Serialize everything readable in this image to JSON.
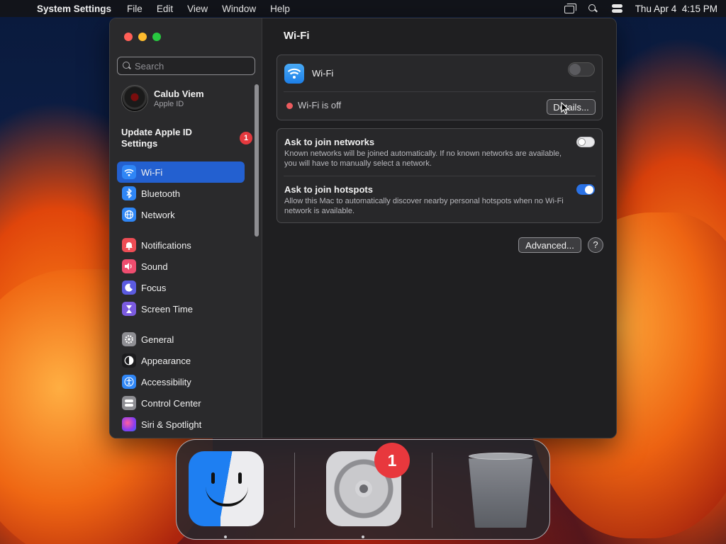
{
  "menubar": {
    "app_name": "System Settings",
    "menus": [
      "File",
      "Edit",
      "View",
      "Window",
      "Help"
    ],
    "clock": "Thu Apr 4  4:15 PM"
  },
  "sidebar": {
    "search_placeholder": "Search",
    "account": {
      "name": "Calub Viem",
      "subtitle": "Apple ID"
    },
    "update": {
      "label": "Update Apple ID Settings",
      "badge": "1"
    },
    "items": [
      {
        "label": "Wi-Fi",
        "icon": "wifi-icon",
        "color": "#2f86f6",
        "active": true
      },
      {
        "label": "Bluetooth",
        "icon": "bluetooth-icon",
        "color": "#2f86f6"
      },
      {
        "label": "Network",
        "icon": "globe-icon",
        "color": "#2f86f6"
      },
      {
        "label": "Notifications",
        "icon": "bell-icon",
        "color": "#ee4d55"
      },
      {
        "label": "Sound",
        "icon": "speaker-icon",
        "color": "#ee4d6f"
      },
      {
        "label": "Focus",
        "icon": "moon-icon",
        "color": "#5b5be0"
      },
      {
        "label": "Screen Time",
        "icon": "hourglass-icon",
        "color": "#7b5be0"
      },
      {
        "label": "General",
        "icon": "gear-icon",
        "color": "#8e8e93"
      },
      {
        "label": "Appearance",
        "icon": "appearance-icon",
        "color": "#1c1c1e"
      },
      {
        "label": "Accessibility",
        "icon": "accessibility-icon",
        "color": "#2f86f6"
      },
      {
        "label": "Control Center",
        "icon": "control-center-icon",
        "color": "#8e8e93"
      },
      {
        "label": "Siri & Spotlight",
        "icon": "siri-icon",
        "color": "#b04fe0"
      }
    ]
  },
  "content": {
    "title": "Wi-Fi",
    "wifi_row_label": "Wi-Fi",
    "wifi_enabled": false,
    "status_text": "Wi-Fi is off",
    "status_color": "#ec5b5e",
    "details_button": "Details...",
    "ask_networks": {
      "title": "Ask to join networks",
      "description": "Known networks will be joined automatically. If no known networks are available, you will have to manually select a network.",
      "enabled": false
    },
    "ask_hotspots": {
      "title": "Ask to join hotspots",
      "description": "Allow this Mac to automatically discover nearby personal hotspots when no Wi-Fi network is available.",
      "enabled": true
    },
    "advanced_button": "Advanced...",
    "help_button": "?"
  },
  "dock": {
    "apps": [
      {
        "name": "Finder",
        "icon": "finder-icon",
        "running": true
      },
      {
        "name": "System Settings",
        "icon": "system-settings-icon",
        "running": true,
        "badge": "1"
      },
      {
        "name": "Trash",
        "icon": "trash-icon",
        "running": false
      }
    ]
  },
  "colors": {
    "accent": "#2360d0",
    "badge_red": "#e5393e"
  }
}
